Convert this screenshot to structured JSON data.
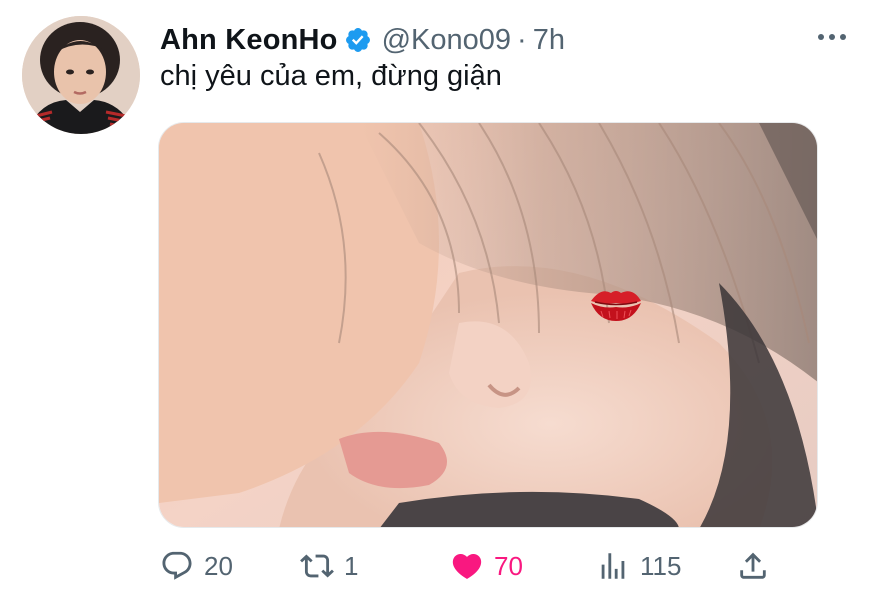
{
  "user": {
    "display_name": "Ahn KeonHo",
    "handle": "@Kono09",
    "separator": "·",
    "time": "7h",
    "verified": true
  },
  "tweet": {
    "text": "chị yêu của em, đừng giận"
  },
  "media": {
    "sticker_icon": "kiss-mark-icon"
  },
  "actions": {
    "reply_count": "20",
    "retweet_count": "1",
    "like_count": "70",
    "views_count": "115"
  },
  "colors": {
    "text": "#0f1419",
    "secondary": "#536471",
    "verified": "#1d9bf0",
    "like": "#f91880"
  },
  "icons": {
    "more": "more-horizontal-icon",
    "reply": "reply-icon",
    "retweet": "retweet-icon",
    "like": "heart-icon",
    "views": "views-chart-icon",
    "share": "share-icon"
  }
}
